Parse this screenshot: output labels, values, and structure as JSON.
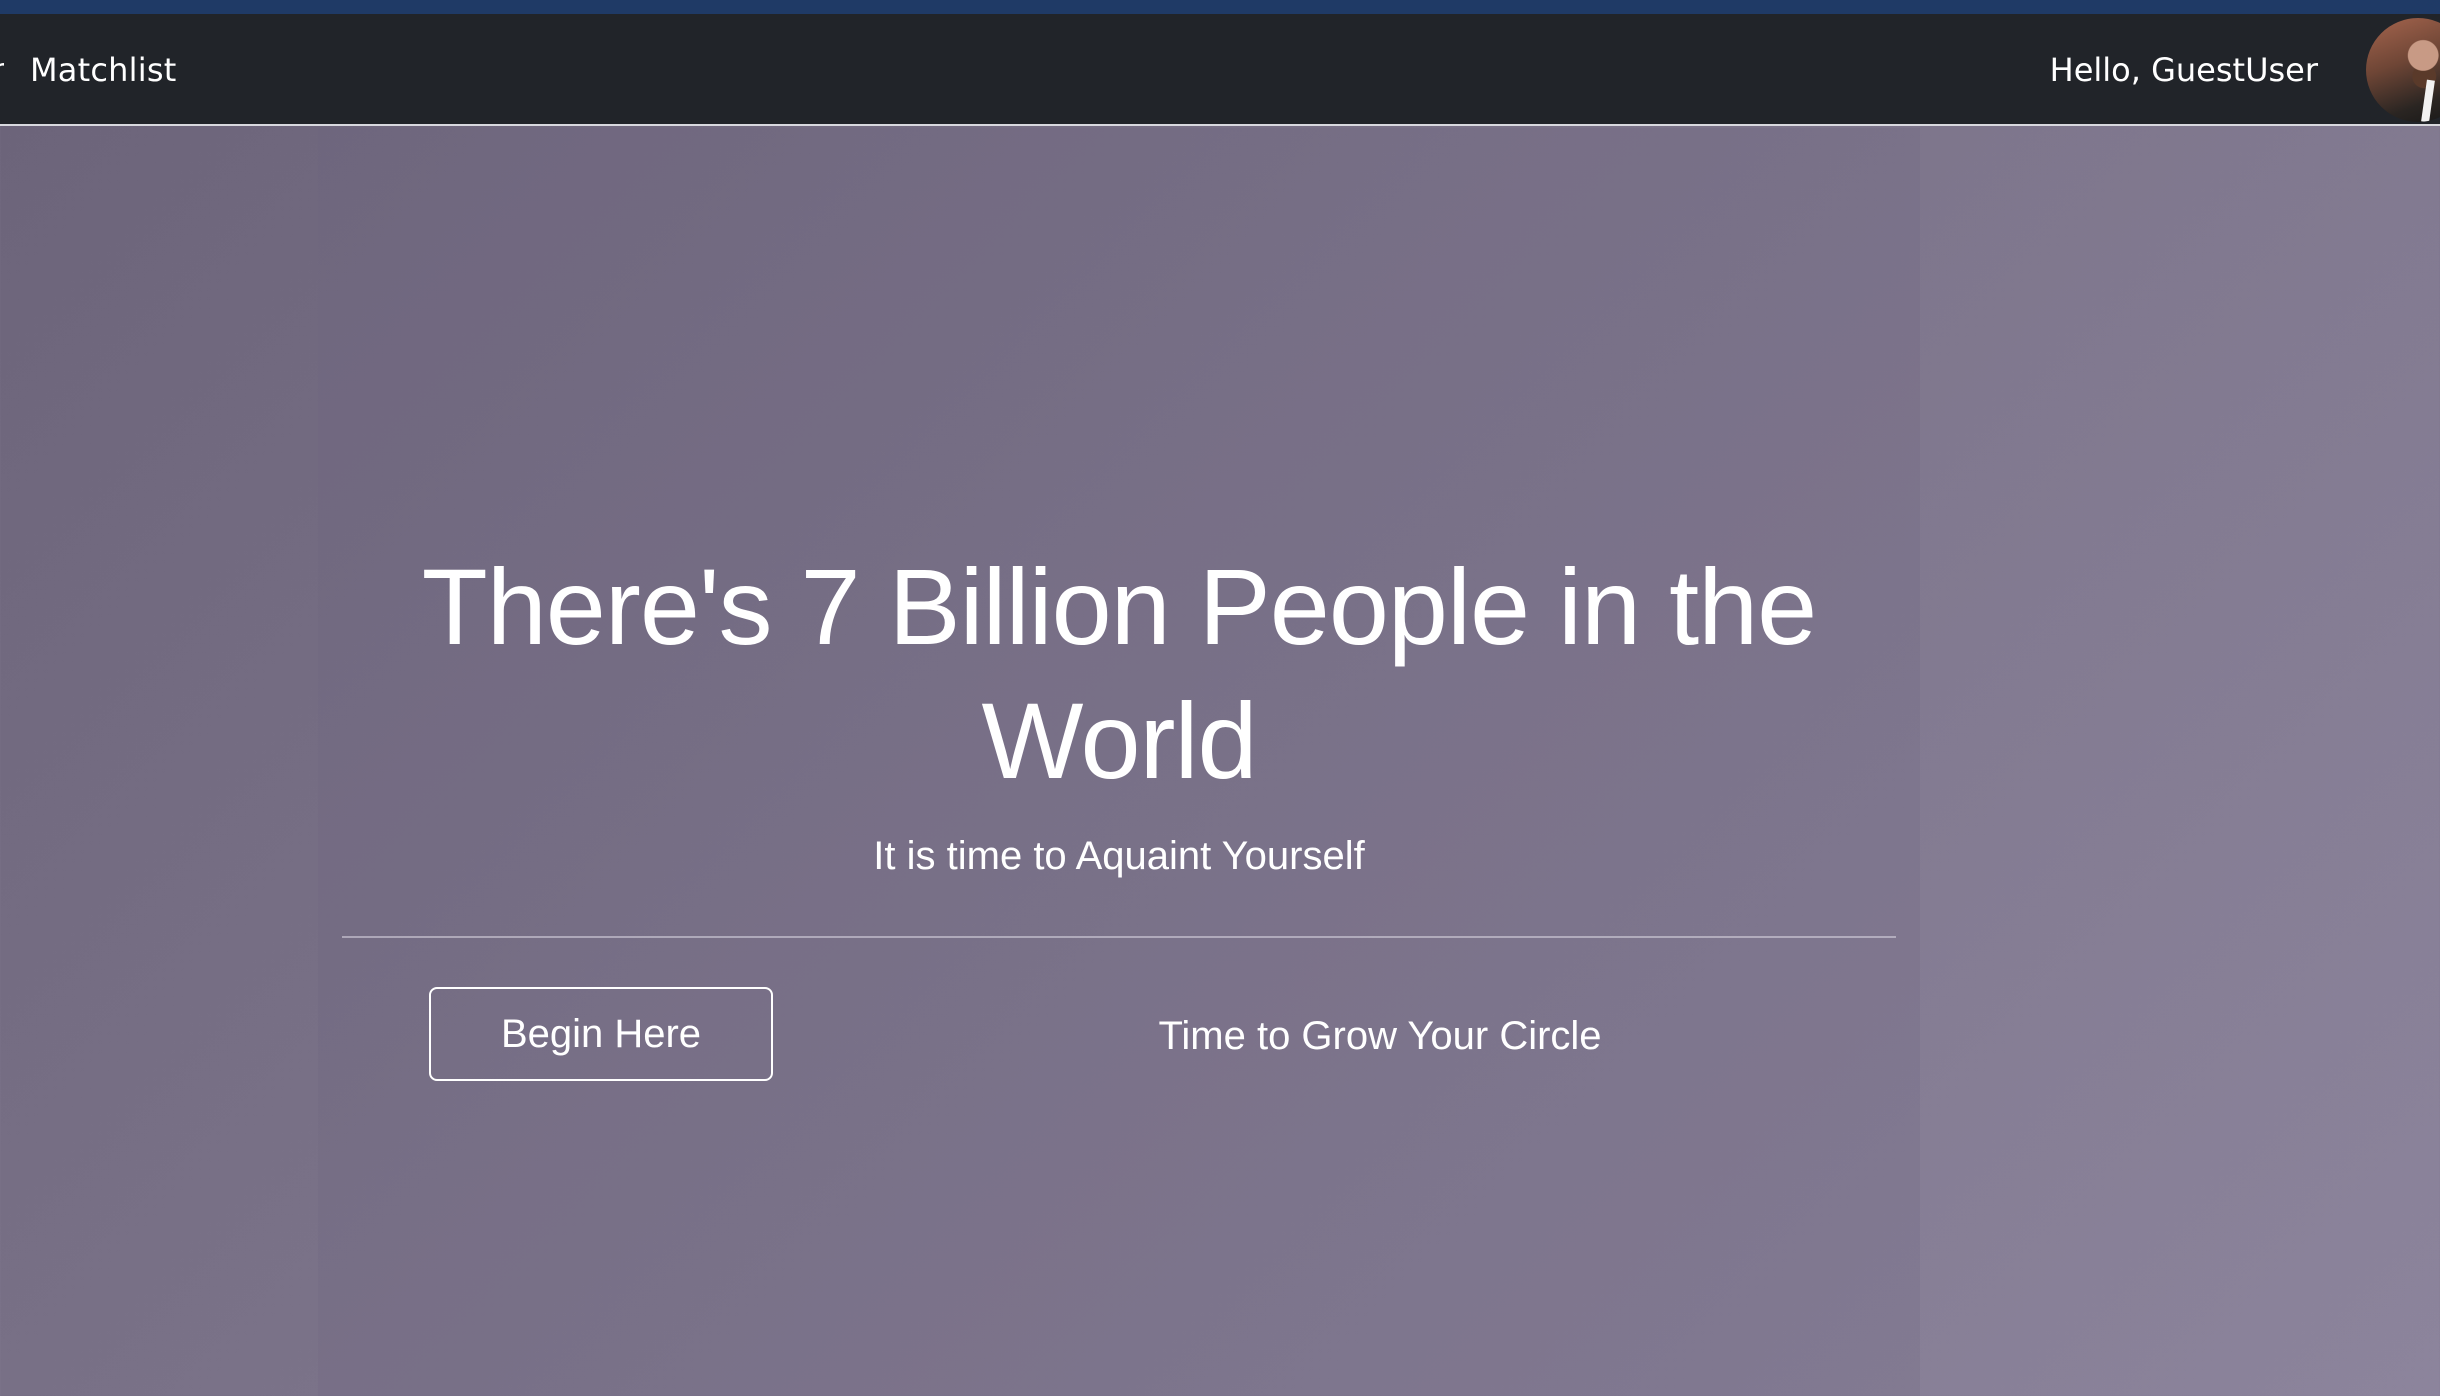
{
  "navbar": {
    "partial_item": "n",
    "items": [
      {
        "label": "Matchlist"
      }
    ],
    "greeting": "Hello, GuestUser",
    "avatar_icon": "user-avatar-photo"
  },
  "hero": {
    "title": "There's 7 Billion People in the World",
    "subtitle": "It is time to Aquaint Yourself",
    "button_label": "Begin Here",
    "tagline": "Time to Grow Your Circle"
  },
  "colors": {
    "top_strip": "#1f3a66",
    "navbar_bg": "#212429",
    "hero_bg": "#7b7389",
    "text": "#ffffff"
  }
}
